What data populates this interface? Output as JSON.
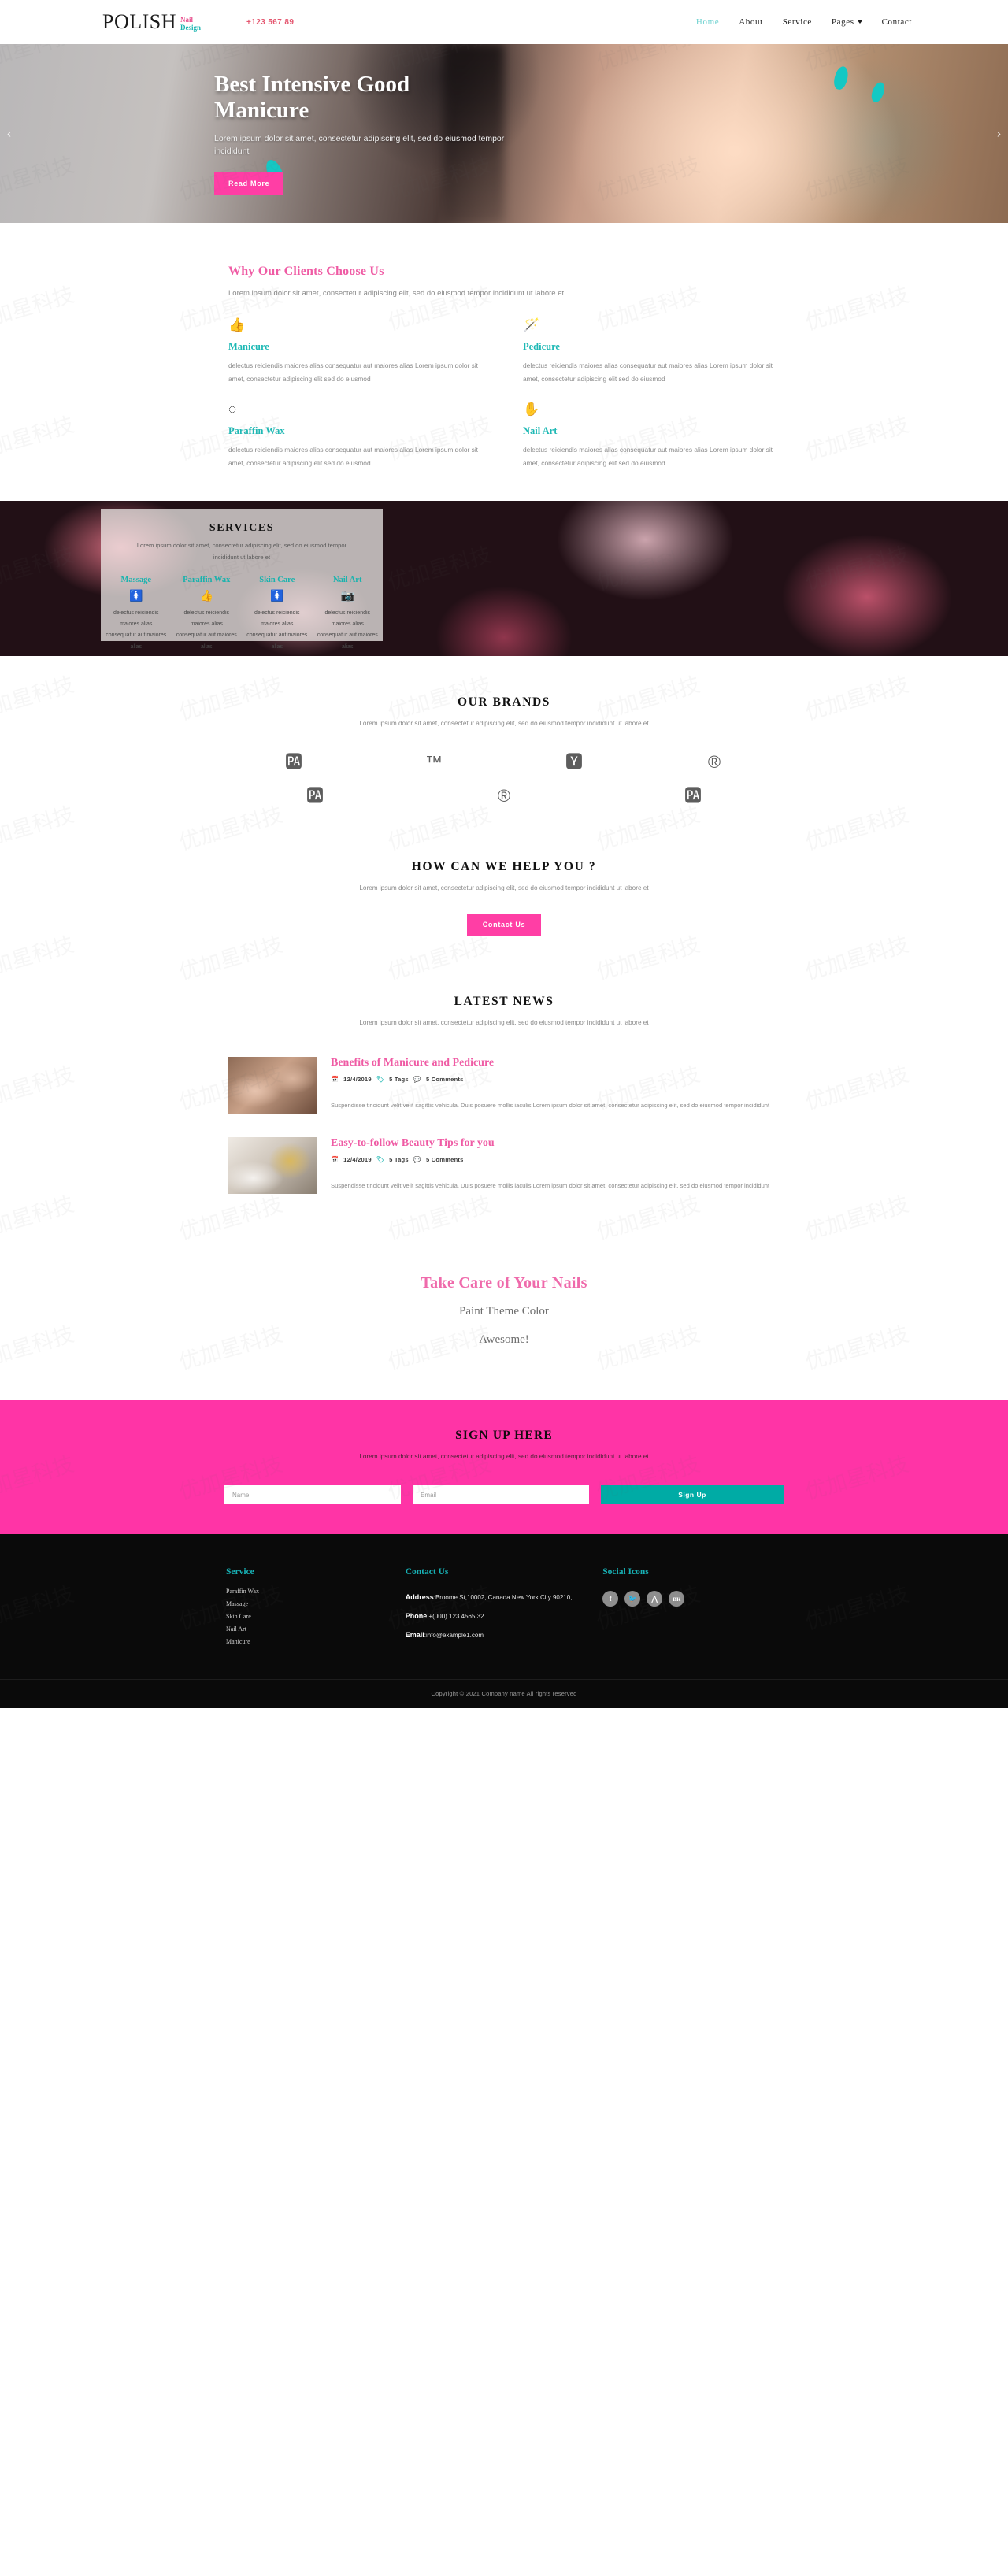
{
  "header": {
    "logo_main": "POLISH",
    "logo_sub_line1": "Nail",
    "logo_sub_line2": "Design",
    "phone": "+123 567 89",
    "nav": [
      {
        "label": "Home",
        "active": true
      },
      {
        "label": "About",
        "active": false
      },
      {
        "label": "Service",
        "active": false
      },
      {
        "label": "Pages",
        "active": false,
        "dropdown": true
      },
      {
        "label": "Contact",
        "active": false
      }
    ]
  },
  "hero": {
    "title": "Best Intensive Good Manicure",
    "subtitle": "Lorem ipsum dolor sit amet, consectetur adipiscing elit, sed do eiusmod tempor incididunt",
    "cta": "Read More",
    "prev_arrow": "‹",
    "next_arrow": "›"
  },
  "why": {
    "title": "Why Our Clients Choose Us",
    "lead": "Lorem ipsum dolor sit amet, consectetur adipiscing elit, sed do eiusmod tempor incididunt ut labore et",
    "features": [
      {
        "icon": "👍",
        "icon_name": "thumbs-up-icon",
        "title": "Manicure",
        "body": "delectus reiciendis maiores alias consequatur aut maiores alias Lorem ipsum dolor sit amet, consectetur adipiscing elit sed do eiusmod"
      },
      {
        "icon": "🪄",
        "icon_name": "magic-wand-icon",
        "title": "Pedicure",
        "body": "delectus reiciendis maiores alias consequatur aut maiores alias Lorem ipsum dolor sit amet, consectetur adipiscing elit sed do eiusmod"
      },
      {
        "icon": "◌",
        "icon_name": "spinner-dots-icon",
        "title": "Paraffin Wax",
        "body": "delectus reiciendis maiores alias consequatur aut maiores alias Lorem ipsum dolor sit amet, consectetur adipiscing elit sed do eiusmod"
      },
      {
        "icon": "✋",
        "icon_name": "hand-icon",
        "title": "Nail Art",
        "body": "delectus reiciendis maiores alias consequatur aut maiores alias Lorem ipsum dolor sit amet, consectetur adipiscing elit sed do eiusmod"
      }
    ]
  },
  "services": {
    "title": "SERVICES",
    "lead": "Lorem ipsum dolor sit amet, consectetur adipiscing elit, sed do eiusmod tempor incididunt ut labore et",
    "cards": [
      {
        "title": "Massage",
        "icon": "🚺",
        "icon_name": "person-icon",
        "body": "delectus reiciendis maiores alias consequatur aut maiores alias"
      },
      {
        "title": "Paraffin Wax",
        "icon": "👍",
        "icon_name": "thumbs-up-icon",
        "body": "delectus reiciendis maiores alias consequatur aut maiores alias"
      },
      {
        "title": "Skin Care",
        "icon": "🚺",
        "icon_name": "person-icon",
        "body": "delectus reiciendis maiores alias consequatur aut maiores alias"
      },
      {
        "title": "Nail Art",
        "icon": "📷",
        "icon_name": "camera-icon",
        "body": "delectus reiciendis maiores alias consequatur aut maiores alias"
      }
    ]
  },
  "brands": {
    "title": "OUR BRANDS",
    "lead": "Lorem ipsum dolor sit amet, consectetur adipiscing elit, sed do eiusmod tempor incididunt ut labore et",
    "row1": [
      {
        "glyph": "🆌",
        "icon_name": "closed-captioning-boxed-icon"
      },
      {
        "glyph": "™",
        "icon_name": "trademark-icon"
      },
      {
        "glyph": "🆈",
        "icon_name": "closed-captioning-circle-icon"
      },
      {
        "glyph": "®",
        "icon_name": "registered-icon"
      }
    ],
    "row2": [
      {
        "glyph": "🆌",
        "icon_name": "closed-captioning-boxed-icon"
      },
      {
        "glyph": "®",
        "icon_name": "registered-icon"
      },
      {
        "glyph": "🆌",
        "icon_name": "closed-captioning-boxed-icon"
      }
    ]
  },
  "help": {
    "title": "HOW CAN WE HELP YOU ?",
    "lead": "Lorem ipsum dolor sit amet, consectetur adipiscing elit, sed do eiusmod tempor incididunt ut labore et",
    "cta": "Contact Us"
  },
  "news": {
    "title": "LATEST NEWS",
    "lead": "Lorem ipsum dolor sit amet, consectetur adipiscing elit, sed do eiusmod tempor incididunt ut labore et",
    "items": [
      {
        "title": "Benefits of Manicure and Pedicure",
        "date": "12/4/2019",
        "tags": "5 Tags",
        "comments": "5 Comments",
        "body": "Suspendisse tincidunt velit velit sagittis vehicula. Duis posuere mollis iaculis.Lorem ipsum dolor sit amet, consectetur adipiscing elit, sed do eiusmod tempor incididunt"
      },
      {
        "title": "Easy-to-follow Beauty Tips for you",
        "date": "12/4/2019",
        "tags": "5 Tags",
        "comments": "5 Comments",
        "body": "Suspendisse tincidunt velit velit sagittis vehicula. Duis posuere mollis iaculis.Lorem ipsum dolor sit amet, consectetur adipiscing elit, sed do eiusmod tempor incididunt"
      }
    ]
  },
  "quote": {
    "title": "Take Care of Your Nails",
    "line1": "Paint Theme Color",
    "line2": "Awesome!"
  },
  "signup": {
    "title": "SIGN UP HERE",
    "lead": "Lorem ipsum dolor sit amet, consectetur adipiscing elit, sed do eiusmod tempor incididunt ut labore et",
    "name_placeholder": "Name",
    "email_placeholder": "Email",
    "button": "Sign Up"
  },
  "footer": {
    "service_title": "Service",
    "service_links": [
      "Paraffin Wax",
      "Massage",
      "Skin Care",
      "Nail Art",
      "Manicure"
    ],
    "contact_title": "Contact Us",
    "address_label": "Address",
    "address_value": ":Broome St,10002, Canada New York City 90210,",
    "phone_label": "Phone",
    "phone_value": ":+(000) 123 4565 32",
    "email_label": "Email",
    "email_value": ":info@example1.com",
    "social_title": "Social Icons",
    "socials": [
      {
        "glyph": "f",
        "icon_name": "facebook-icon"
      },
      {
        "glyph": "🐦",
        "icon_name": "twitter-icon"
      },
      {
        "glyph": "⋀",
        "icon_name": "rss-icon"
      },
      {
        "glyph": "вк",
        "icon_name": "vk-icon"
      }
    ],
    "copyright": "Copyright © 2021 Company name All rights reserved"
  },
  "colors": {
    "pink": "#ff34a6",
    "pink_heading": "#ef5ba4",
    "teal": "#17b0b4",
    "dark": "#0a0a0a"
  }
}
